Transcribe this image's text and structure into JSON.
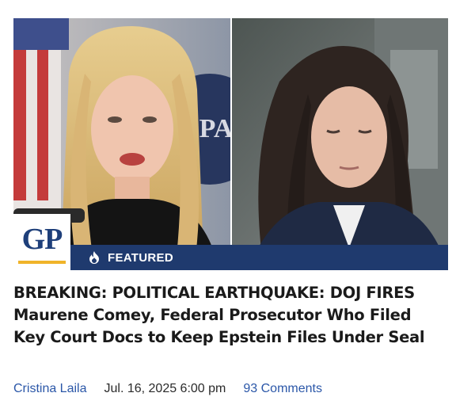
{
  "article": {
    "badge_label": "FEATURED",
    "logo_text": "GP",
    "headline": "BREAKING: POLITICAL EARTHQUAKE: DOJ FIRES Maurene Comey, Federal Prosecutor Who Filed Key Court Docs to Keep Epstein Files Under Seal",
    "author": "Cristina Laila",
    "date": "Jul. 16, 2025 6:00 pm",
    "comments": "93 Comments",
    "background_sign_text": "EPA"
  },
  "colors": {
    "badge_bg": "#1f3a6e",
    "link": "#2b57a8",
    "logo": "#1e3f7a",
    "logo_accent": "#f0b429"
  },
  "icons": {
    "featured": "fire-icon"
  }
}
